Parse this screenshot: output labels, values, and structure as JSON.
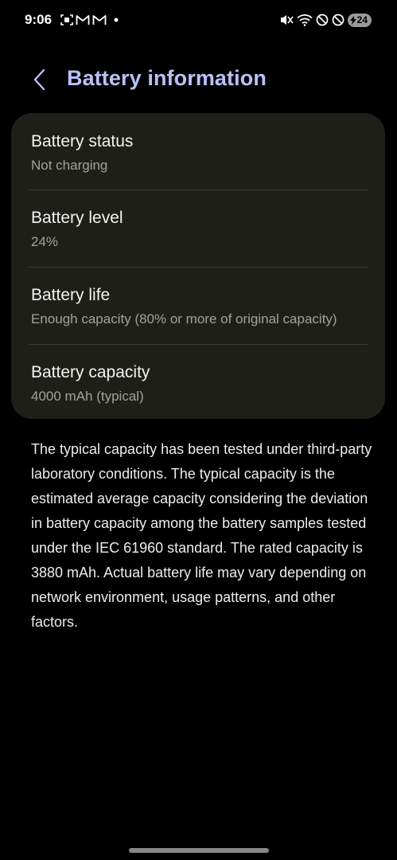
{
  "status_bar": {
    "time": "9:06",
    "battery_percent": "24",
    "left_icons": [
      "screenshot-icon",
      "gmail-icon",
      "gmail-icon",
      "dot-icon"
    ],
    "right_icons": [
      "mute-icon",
      "wifi-icon",
      "do-not-disturb-icon",
      "do-not-disturb-icon",
      "battery-icon"
    ]
  },
  "header": {
    "title": "Battery information",
    "title_color": "#b9c2f5"
  },
  "items": [
    {
      "title": "Battery status",
      "value": "Not charging"
    },
    {
      "title": "Battery level",
      "value": "24%"
    },
    {
      "title": "Battery life",
      "value": "Enough capacity (80% or more of original capacity)"
    },
    {
      "title": "Battery capacity",
      "value": "4000 mAh (typical)"
    }
  ],
  "description": "The typical capacity has been tested under third-party laboratory conditions. The typical capacity is the estimated average capacity considering the deviation in battery capacity among the battery samples tested under the IEC 61960 standard. The rated capacity is 3880 mAh. Actual battery life may vary depending on network environment, usage patterns, and other factors.",
  "colors": {
    "background": "#000000",
    "card": "#1f1f1a",
    "secondary_text": "#a3a39e"
  }
}
